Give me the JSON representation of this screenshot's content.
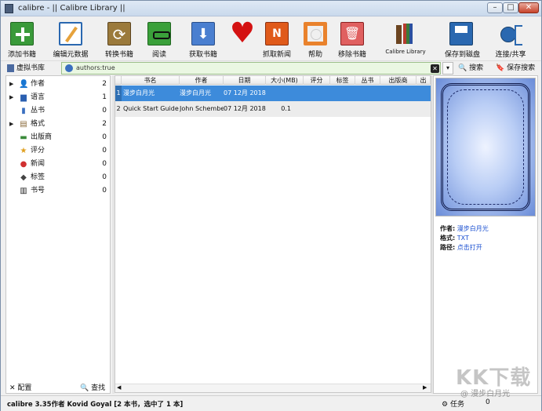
{
  "window": {
    "title": "calibre - || Calibre Library ||",
    "controls": [
      "–",
      "□",
      "✕"
    ]
  },
  "toolbar": {
    "buttons": [
      {
        "label": "添加书籍",
        "icon": "add-book-icon"
      },
      {
        "label": "编辑元数据",
        "icon": "edit-metadata-icon"
      },
      {
        "label": "转换书籍",
        "icon": "convert-books-icon"
      },
      {
        "label": "阅读",
        "icon": "read-book-icon"
      },
      {
        "label": "获取书籍",
        "icon": "get-books-icon"
      },
      {
        "label": "",
        "icon": "heart-donate-icon"
      },
      {
        "label": "抓取新闻",
        "icon": "fetch-news-icon"
      },
      {
        "label": "帮助",
        "icon": "help-lifebuoy-icon"
      },
      {
        "label": "移除书籍",
        "icon": "remove-books-icon"
      },
      {
        "label": "Calibre Library",
        "icon": "library-shelf-icon"
      },
      {
        "label": "保存到磁盘",
        "icon": "save-to-disk-icon"
      },
      {
        "label": "连接/共享",
        "icon": "connect-share-icon"
      }
    ]
  },
  "searchbar": {
    "virtual_library": "虚拟书库",
    "query": "authors:true",
    "clear_symbol": "✕",
    "dropdown_symbol": "▾",
    "search_label": "搜索",
    "save_search_label": "保存搜索"
  },
  "tag_browser": {
    "items": [
      {
        "label": "作者",
        "count": "2",
        "expandable": true,
        "icon": "person-icon",
        "color": "#222222"
      },
      {
        "label": "语言",
        "count": "1",
        "expandable": true,
        "icon": "language-icon",
        "color": "#2a5fb0"
      },
      {
        "label": "丛书",
        "count": "0",
        "expandable": false,
        "icon": "series-icon",
        "color": "#3a6fc0"
      },
      {
        "label": "格式",
        "count": "2",
        "expandable": true,
        "icon": "format-icon",
        "color": "#8a6a3a"
      },
      {
        "label": "出版商",
        "count": "0",
        "expandable": false,
        "icon": "publisher-icon",
        "color": "#3a8a3a"
      },
      {
        "label": "评分",
        "count": "0",
        "expandable": false,
        "icon": "rating-star-icon",
        "color": "#e0a020"
      },
      {
        "label": "新闻",
        "count": "0",
        "expandable": false,
        "icon": "news-pin-icon",
        "color": "#d03030"
      },
      {
        "label": "标签",
        "count": "0",
        "expandable": false,
        "icon": "tag-icon",
        "color": "#444444"
      },
      {
        "label": "书号",
        "count": "0",
        "expandable": false,
        "icon": "barcode-icon",
        "color": "#222222"
      }
    ],
    "configure_label": "配置",
    "find_label": "查找"
  },
  "book_list": {
    "columns": [
      "书名",
      "作者",
      "日期",
      "大小(MB)",
      "评分",
      "标签",
      "丛书",
      "出版商",
      "出"
    ],
    "rows": [
      {
        "marker": "1",
        "title": "漫步白月光",
        "author": "漫步白月光",
        "date": "07 12月 2018",
        "size": "",
        "selected": true
      },
      {
        "marker": "2",
        "title": "Quick Start Guide",
        "author": "John Schember",
        "date": "07 12月 2018",
        "size": "0.1",
        "selected": false
      }
    ]
  },
  "book_details": {
    "author_key": "作者:",
    "author_value": "漫步白月光",
    "format_key": "格式:",
    "format_value": "TXT",
    "path_key": "路径:",
    "path_value": "点击打开"
  },
  "statusbar": {
    "text": "calibre 3.35作者 Kovid Goyal  [2 本书，选中了 1 本]",
    "jobs_label": "任务",
    "jobs_count": "0"
  },
  "watermark": {
    "text": "KK下载",
    "subtext": "@ 漫步白月光"
  }
}
